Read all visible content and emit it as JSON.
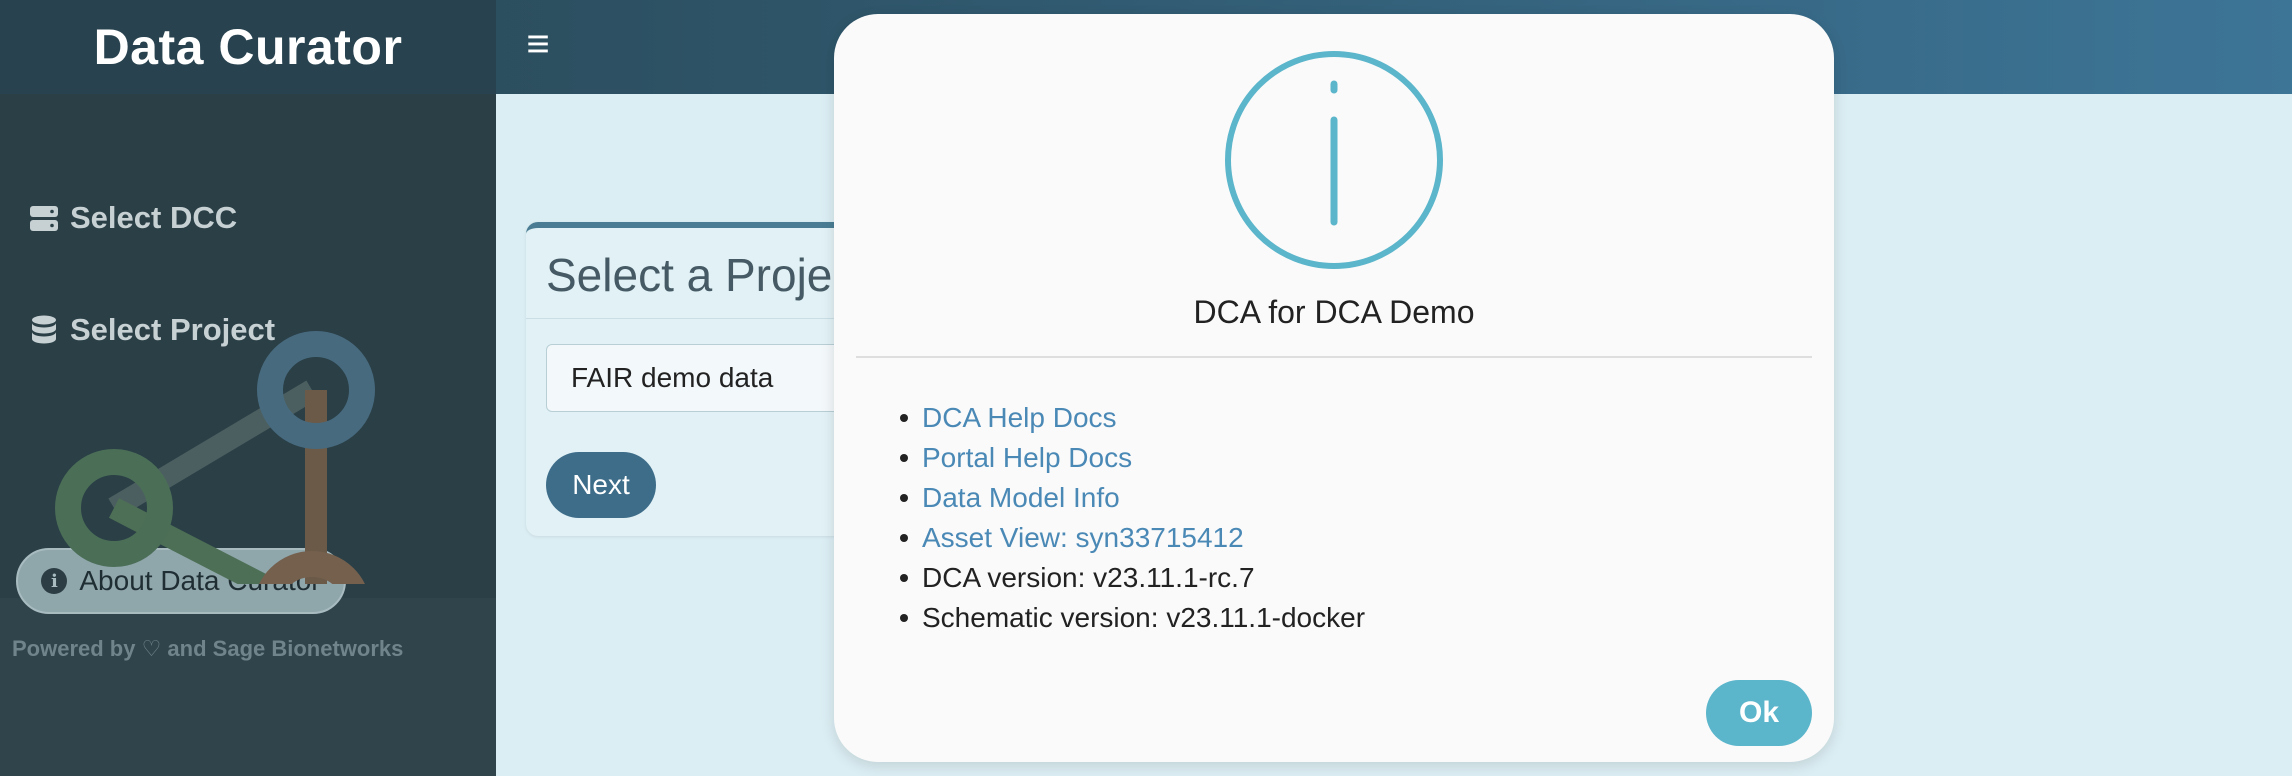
{
  "header": {
    "app_title": "Data Curator",
    "menu_icon": "hamburger-icon",
    "menu_glyph": "≡"
  },
  "sidebar": {
    "items": [
      {
        "label": "Select DCC",
        "icon": "server-icon"
      },
      {
        "label": "Select Project",
        "icon": "database-icon"
      }
    ],
    "about_button": {
      "label": "About Data Curator",
      "icon": "info-icon",
      "icon_glyph": "i"
    },
    "powered_by": "Powered by ♡ and Sage Bionetworks"
  },
  "main": {
    "card_title": "Select a Project",
    "project_select": {
      "value": "FAIR demo data"
    },
    "next_button": "Next"
  },
  "modal": {
    "icon": "info-circle-icon",
    "title": "DCA for DCA Demo",
    "links": [
      "DCA Help Docs",
      "Portal Help Docs",
      "Data Model Info",
      "Asset View: syn33715412"
    ],
    "info": [
      "DCA version: v23.11.1-rc.7",
      "Schematic version: v23.11.1-docker"
    ],
    "ok_button": "Ok"
  },
  "colors": {
    "modal_accent": "#5bb5cb",
    "link": "#4a89b6",
    "primary_button": "#3e6d8a"
  }
}
